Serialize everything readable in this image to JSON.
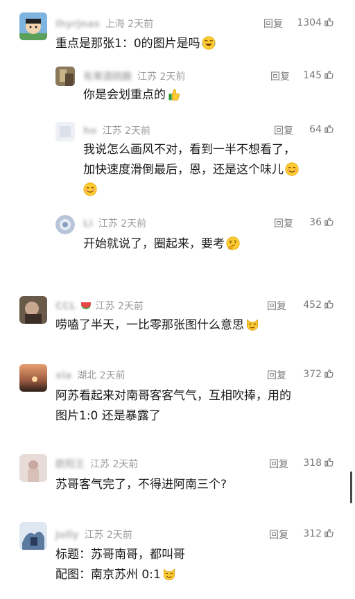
{
  "ui": {
    "reply_label": "回复"
  },
  "comments": [
    {
      "name": "Ihyrjnas",
      "location": "上海",
      "time": "2天前",
      "likes": "1304",
      "text": "重点是那张1：0的图片是吗",
      "emoji": "laugh-cry-emoji"
    },
    {
      "name": "有果酒桃酸",
      "location": "江苏",
      "time": "2天前",
      "likes": "145",
      "text": "你是会划重点的",
      "emoji": "thumbs-up-emoji"
    },
    {
      "name": "ho",
      "location": "江苏",
      "time": "2天前",
      "likes": "64",
      "text_line1": "我说怎么画风不对，看到一半不想看了，",
      "text_line2": "加快速度滑倒最后，恩，还是这个味儿",
      "emoji": "blush-emoji"
    },
    {
      "name": "Li",
      "location": "江苏",
      "time": "2天前",
      "likes": "36",
      "text": "开始就说了，圈起来，要考",
      "emoji": "thinking-emoji"
    },
    {
      "name": "CCL",
      "location": "江苏",
      "time": "2天前",
      "likes": "452",
      "text": "唠嗑了半天，一比零那张图什么意思",
      "emoji": "cat-emoji"
    },
    {
      "name": "xia",
      "location": "湖北",
      "time": "2天前",
      "likes": "372",
      "text_line1": "阿苏看起来对南哥客客气气，互相吹捧，用的",
      "text_line2": "图片1:0 还是暴露了"
    },
    {
      "name": "欧阳王",
      "location": "江苏",
      "time": "2天前",
      "likes": "318",
      "text": "苏哥客气完了，不得进阿南三个?"
    },
    {
      "name": "Jolly",
      "location": "江苏",
      "time": "2天前",
      "likes": "312",
      "text_line1": "标题：苏哥南哥，都叫哥",
      "text_line2": "配图：南京苏州 0:1",
      "emoji": "cat-emoji"
    }
  ]
}
